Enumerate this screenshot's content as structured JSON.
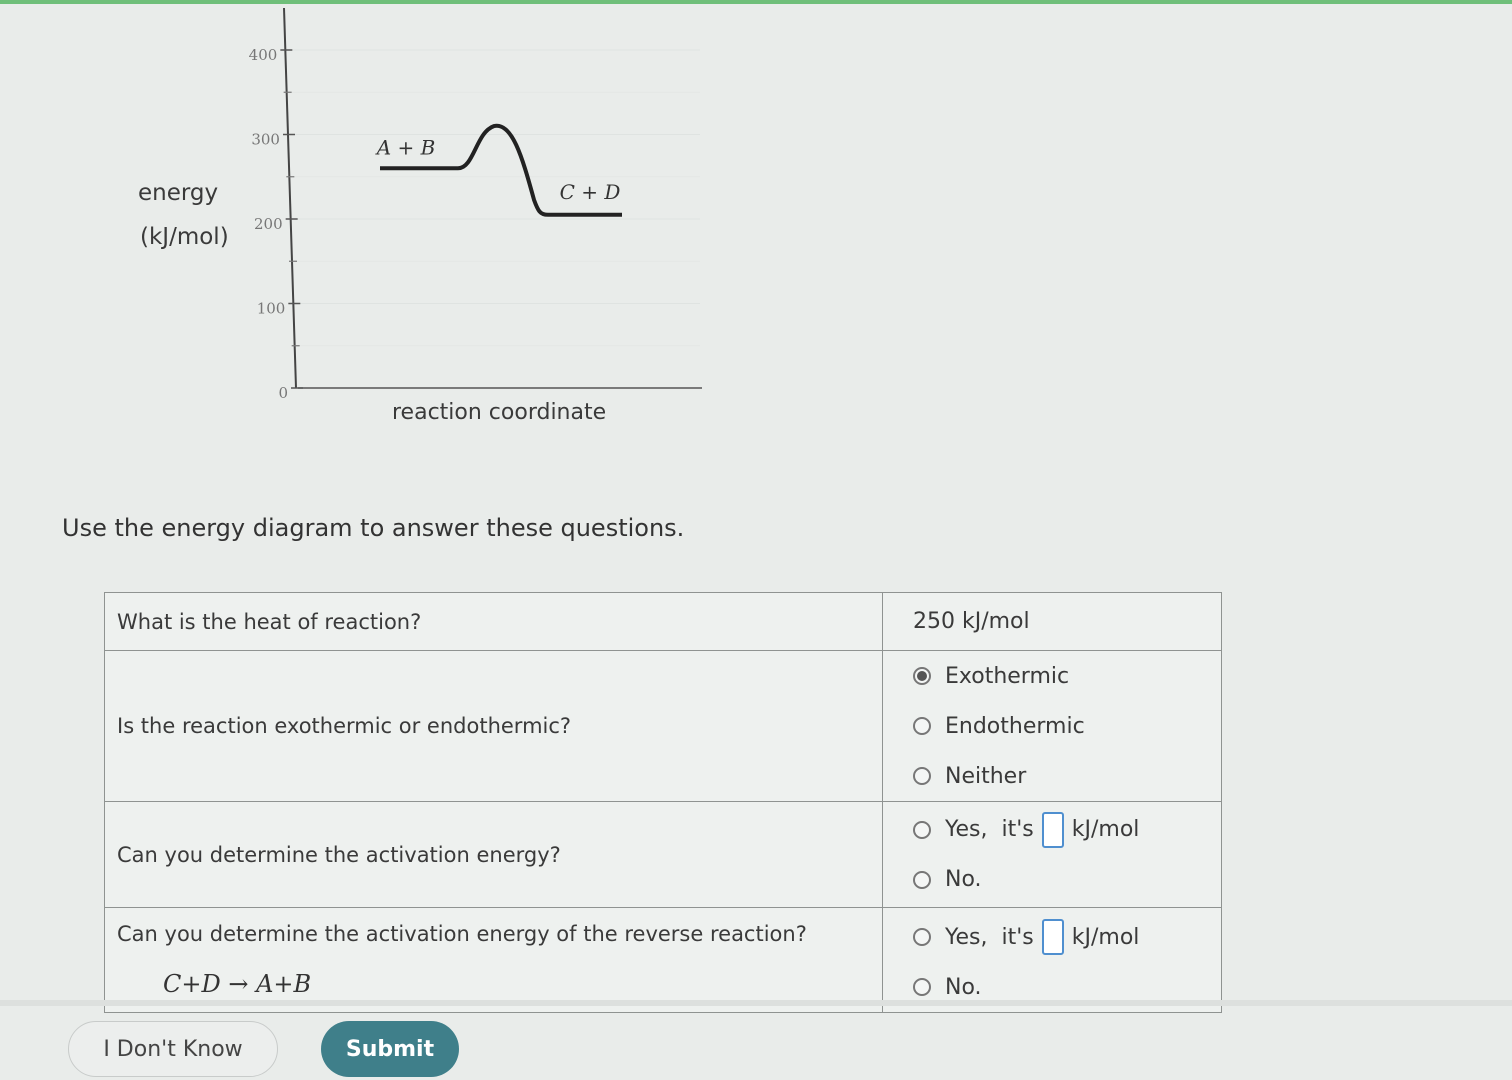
{
  "diagram": {
    "ylabel_line1": "energy",
    "ylabel_line2": "(kJ/mol)",
    "xlabel": "reaction coordinate",
    "ticks": [
      "0",
      "100",
      "200",
      "300",
      "400"
    ],
    "reactants_label": "A + B",
    "products_label": "C + D",
    "reactant_energy": 260,
    "peak_energy": 310,
    "product_energy": 205
  },
  "instructions": "Use the energy diagram to answer these questions.",
  "questions": {
    "q1": {
      "prompt": "What is the heat of reaction?",
      "answer": "250 kJ/mol"
    },
    "q2": {
      "prompt": "Is the reaction exothermic or endothermic?",
      "options": [
        "Exothermic",
        "Endothermic",
        "Neither"
      ],
      "selected": "Exothermic"
    },
    "q3": {
      "prompt": "Can you determine the activation energy?",
      "yes_label": "Yes,",
      "its_label": "it's",
      "unit": "kJ/mol",
      "no_label": "No."
    },
    "q4": {
      "prompt": "Can you determine the activation energy of the reverse reaction?",
      "equation": "C+D → A+B",
      "yes_label": "Yes,",
      "its_label": "it's",
      "unit": "kJ/mol",
      "no_label": "No."
    }
  },
  "buttons": {
    "idk": "I Don't Know",
    "submit": "Submit"
  }
}
